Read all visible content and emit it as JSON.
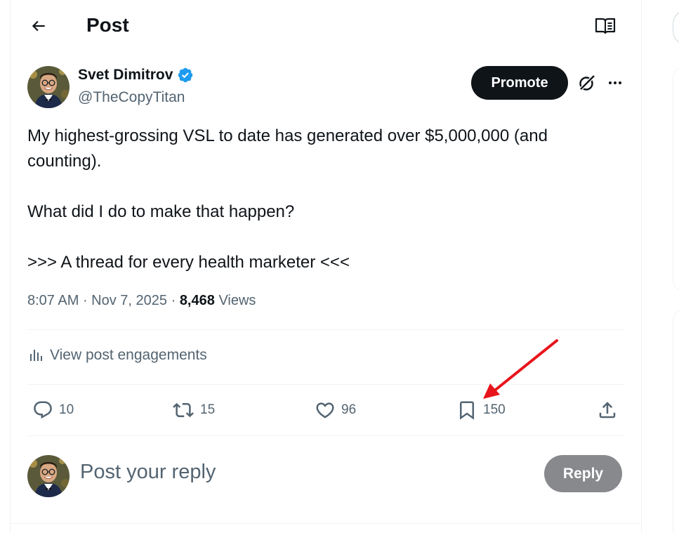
{
  "header": {
    "title": "Post"
  },
  "author": {
    "name": "Svet Dimitrov",
    "handle": "@TheCopyTitan",
    "verified": true
  },
  "actions_top": {
    "promote_label": "Promote"
  },
  "post": {
    "lines": [
      "My highest-grossing VSL to date has generated over $5,000,000 (and counting).",
      "What did I do to make that happen?",
      ">>> A thread for every health marketer <<<"
    ],
    "time": "8:07 AM",
    "date": "Nov 7, 2025",
    "separator": " · ",
    "views_count": "8,468",
    "views_label": "Views"
  },
  "engagements_label": "View post engagements",
  "stats": {
    "replies": "10",
    "reposts": "15",
    "likes": "96",
    "bookmarks": "150"
  },
  "reply_box": {
    "placeholder": "Post your reply",
    "button_label": "Reply"
  },
  "colors": {
    "accent": "#1d9bf0",
    "text": "#0f1419",
    "secondary": "#536471",
    "annotation_arrow": "#e8141b"
  },
  "icons": [
    "back-arrow-icon",
    "reader-icon",
    "verified-icon",
    "grok-icon",
    "more-icon",
    "analytics-icon",
    "reply-icon",
    "repost-icon",
    "like-icon",
    "bookmark-icon",
    "share-icon"
  ]
}
